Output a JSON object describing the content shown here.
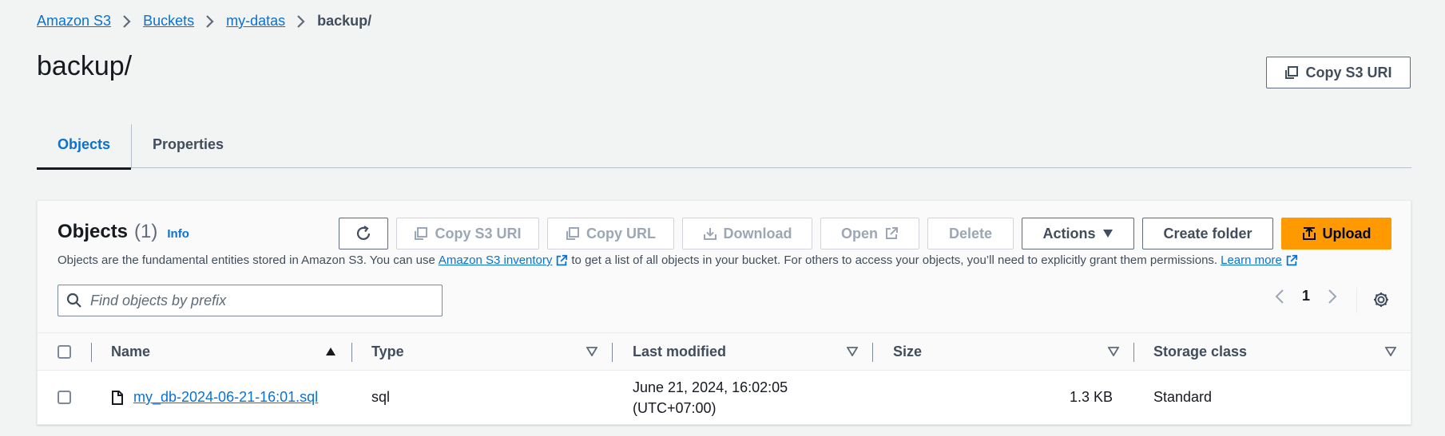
{
  "breadcrumb": [
    "Amazon S3",
    "Buckets",
    "my-datas",
    "backup/"
  ],
  "page_title": "backup/",
  "header_copy_uri": "Copy S3 URI",
  "tabs": [
    {
      "label": "Objects",
      "active": true
    },
    {
      "label": "Properties",
      "active": false
    }
  ],
  "objects_panel": {
    "title": "Objects",
    "count": "(1)",
    "info": "Info",
    "buttons": {
      "refresh": "refresh-icon",
      "copy_uri": "Copy S3 URI",
      "copy_url": "Copy URL",
      "download": "Download",
      "open": "Open",
      "delete": "Delete",
      "actions": "Actions",
      "create_folder": "Create folder",
      "upload": "Upload"
    },
    "description": {
      "part1": "Objects are the fundamental entities stored in Amazon S3. You can use",
      "link1": "Amazon S3 inventory",
      "part2": "to get a list of all objects in your bucket. For others to access your objects, you’ll need to explicitly grant them permissions.",
      "link2": "Learn more"
    },
    "search_placeholder": "Find objects by prefix",
    "current_page": "1"
  },
  "table": {
    "columns": [
      "Name",
      "Type",
      "Last modified",
      "Size",
      "Storage class"
    ],
    "rows": [
      {
        "name": "my_db-2024-06-21-16:01.sql",
        "type": "sql",
        "modified_line1": "June 21, 2024, 16:02:05",
        "modified_line2": "(UTC+07:00)",
        "size": "1.3 KB",
        "storage_class": "Standard"
      }
    ]
  },
  "colors": {
    "link": "#0972d3",
    "primary": "#ff9900",
    "background": "#f2f3f3"
  }
}
